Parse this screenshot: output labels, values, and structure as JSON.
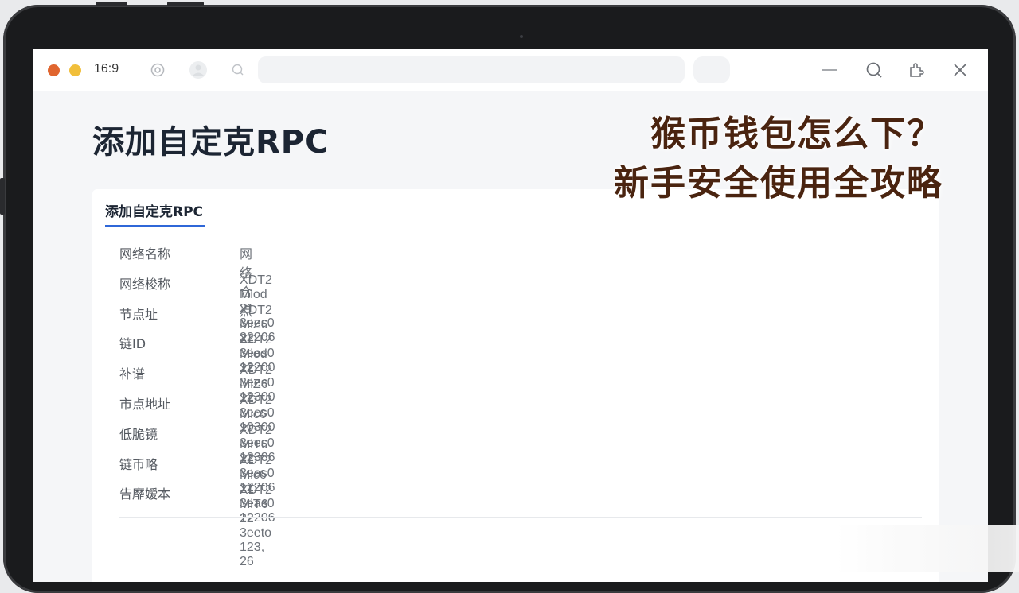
{
  "titlebar": {
    "ratio_label": "16:9",
    "traffic_colors": [
      "#e0652f",
      "#f1bf3b"
    ]
  },
  "page": {
    "title": "添加自定克RPC"
  },
  "overlay": {
    "line1": "猴币钱包怎么下？",
    "line2": "新手安全使用全攻略"
  },
  "card": {
    "tab_label": "添加自定克RPC",
    "rows": [
      {
        "label": "网络名称",
        "value": "网络合点"
      },
      {
        "label": "网络梭称",
        "value": "XDT2 Miod 21 3ees0 22206"
      },
      {
        "label": "节点址",
        "value": "XDT2 MiZ6 22 3ees0 12200"
      },
      {
        "label": "链ID",
        "value": "XDT2 Miod 22 3ees0 12300"
      },
      {
        "label": "补谱",
        "value": "XDT2 MiZ6 22 3ees0 10300"
      },
      {
        "label": "市点地址",
        "value": "XDT2 Mic6 22 3ees0 12386"
      },
      {
        "label": "低脆镜",
        "value": "XDT2 MiT6 22 3eas0 12206"
      },
      {
        "label": "链币略",
        "value": "XDT2 Mic6 21 3eas0 12206"
      },
      {
        "label": "告靡嫒本",
        "value": "XDT2 MiT6 22 3eeto 123, 26"
      }
    ]
  }
}
